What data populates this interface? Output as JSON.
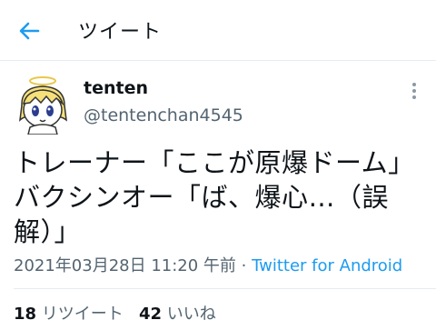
{
  "header": {
    "title": "ツイート",
    "back_icon": "arrow-left-icon",
    "accent_color": "#1d9bf0"
  },
  "author": {
    "display_name": "tenten",
    "handle": "@tentenchan4545",
    "avatar_icon": "avatar-angel-character"
  },
  "tweet": {
    "text": "トレーナー「ここが原爆ドーム」\nバクシンオー「ば、爆心…（誤\n解）」",
    "timestamp": "2021年03月28日 11:20 午前",
    "separator": " · ",
    "source": "Twitter for Android"
  },
  "stats": {
    "retweets_count": "18",
    "retweets_label": "リツイート",
    "likes_count": "42",
    "likes_label": "いいね"
  }
}
